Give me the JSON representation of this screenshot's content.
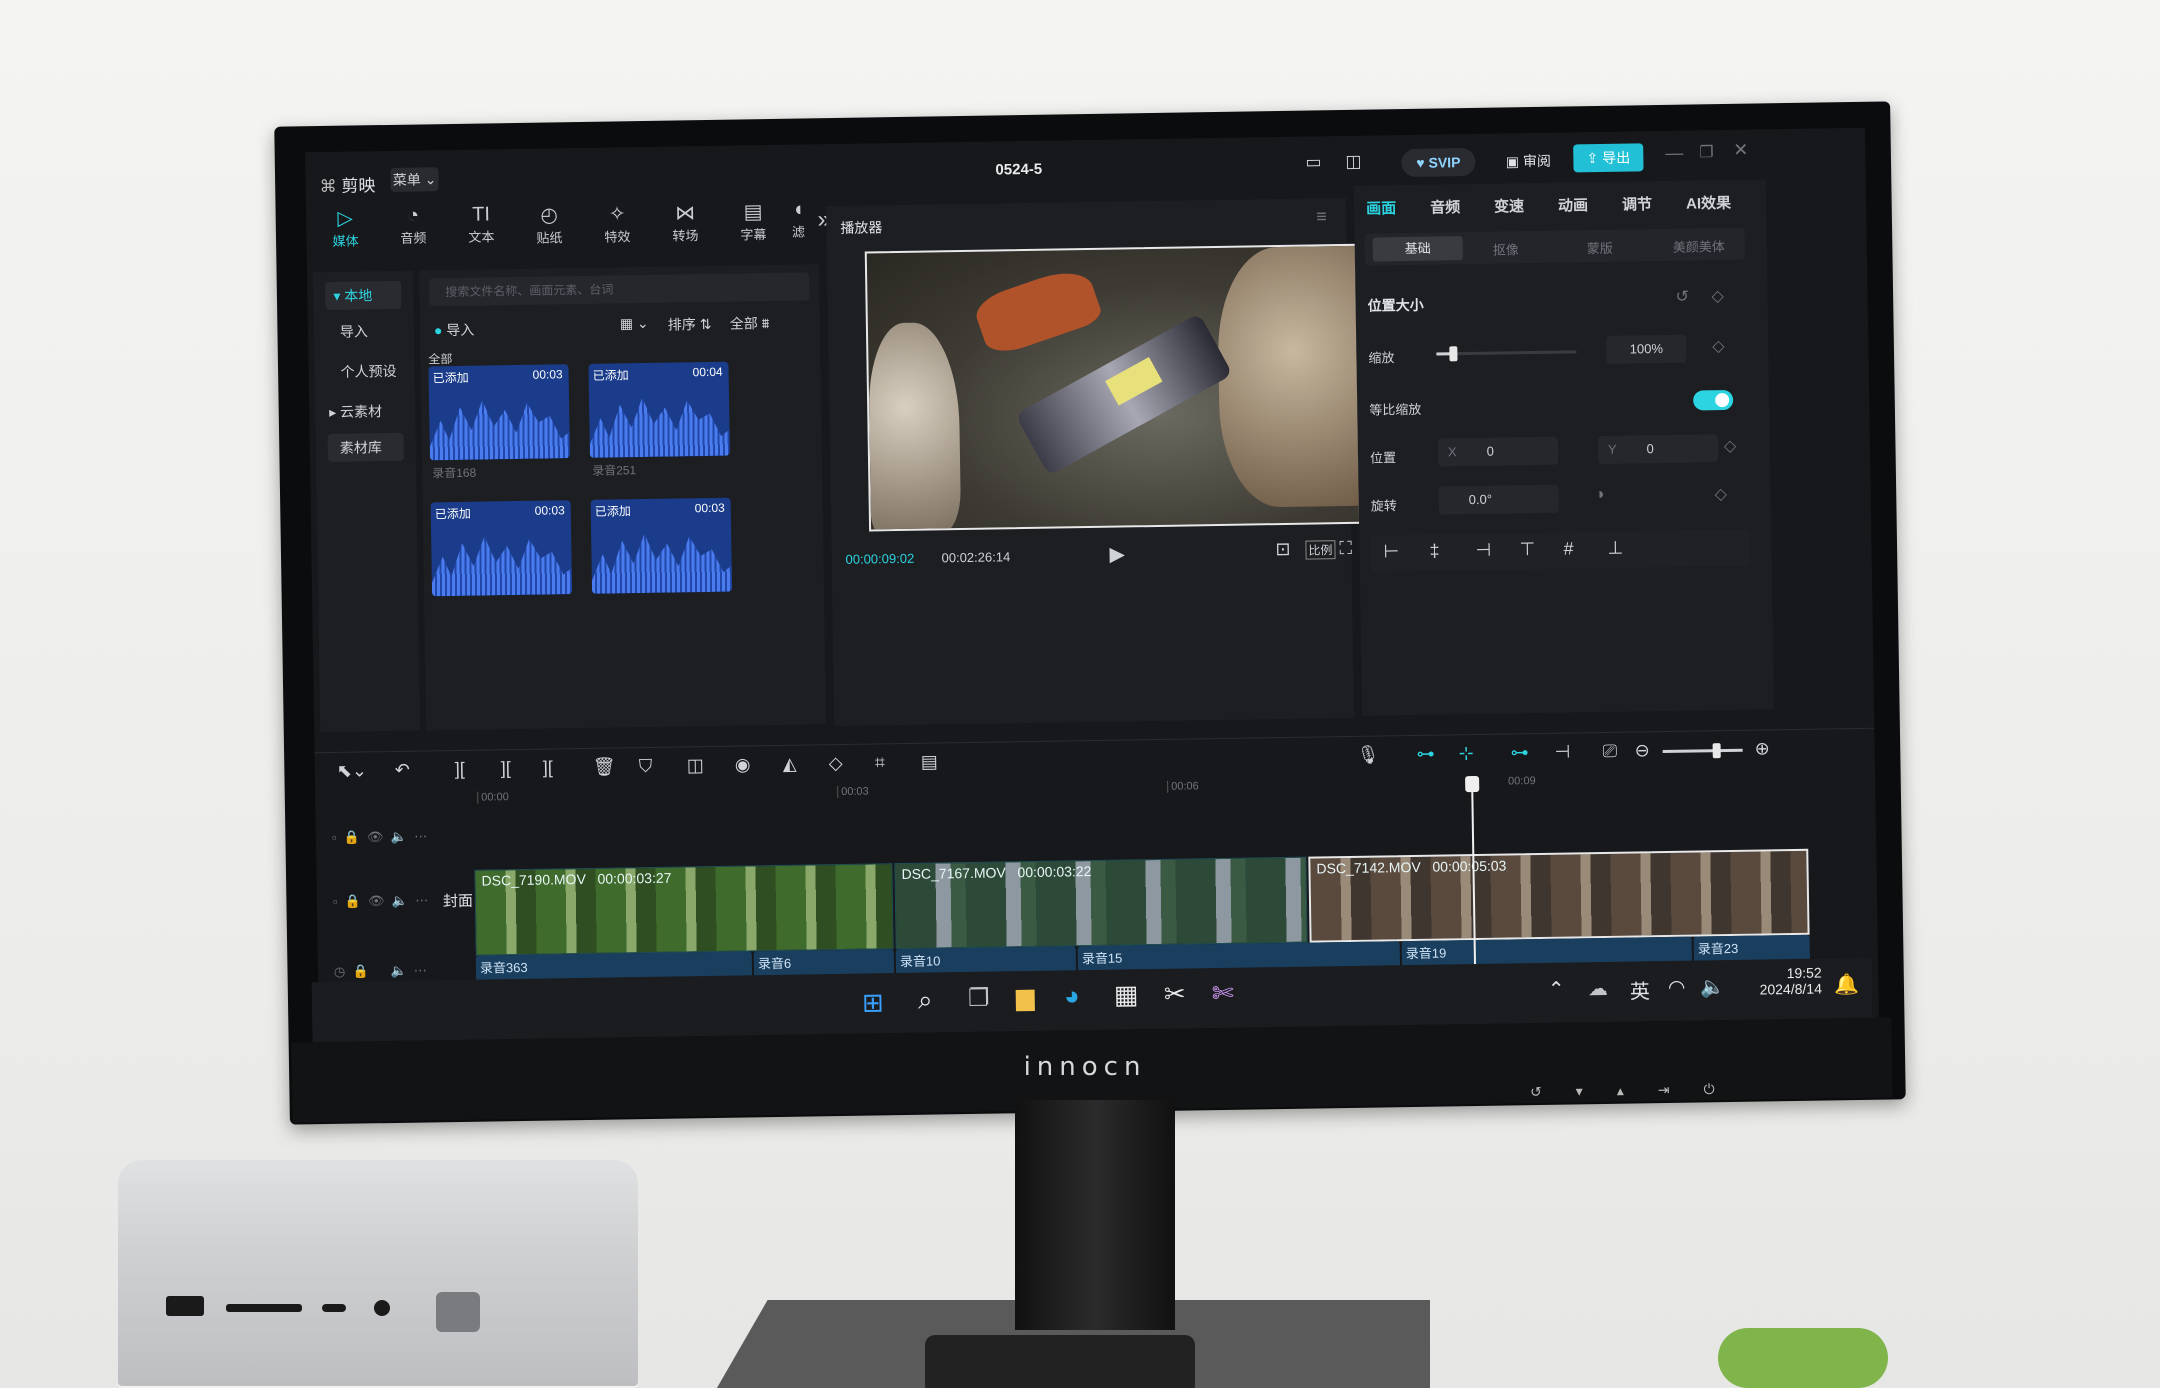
{
  "app": {
    "logo": "剪映",
    "menu": "菜单",
    "project_title": "0524-5",
    "svip": "SVIP",
    "review": "审阅",
    "export": "导出"
  },
  "toolbar_tabs": [
    {
      "label": "媒体",
      "icon": "media-icon"
    },
    {
      "label": "音频",
      "icon": "audio-icon"
    },
    {
      "label": "文本",
      "icon": "text-icon",
      "glyph": "TI"
    },
    {
      "label": "贴纸",
      "icon": "sticker-icon"
    },
    {
      "label": "特效",
      "icon": "effects-icon"
    },
    {
      "label": "转场",
      "icon": "transition-icon"
    },
    {
      "label": "字幕",
      "icon": "caption-icon"
    },
    {
      "label": "滤",
      "icon": "filter-icon"
    }
  ],
  "sidebar": {
    "items": [
      "本地",
      "导入",
      "个人预设",
      "云素材",
      "素材库"
    ]
  },
  "media": {
    "search_placeholder": "搜索文件名称、画面元素、台词",
    "import": "导入",
    "sort": "排序",
    "filter": "全部",
    "section_all": "全部",
    "items": [
      {
        "tag": "已添加",
        "duration": "00:03",
        "name": "录音168"
      },
      {
        "tag": "已添加",
        "duration": "00:04",
        "name": "录音251"
      },
      {
        "tag": "已添加",
        "duration": "00:03",
        "name": ""
      },
      {
        "tag": "已添加",
        "duration": "00:03",
        "name": ""
      }
    ]
  },
  "player": {
    "title": "播放器",
    "current_time": "00:00:09:02",
    "total_time": "00:02:26:14",
    "ratio": "比例"
  },
  "inspector": {
    "tabs": [
      "画面",
      "音频",
      "变速",
      "动画",
      "调节",
      "AI效果"
    ],
    "subtabs": [
      "基础",
      "抠像",
      "蒙版",
      "美颜美体"
    ],
    "section": "位置大小",
    "scale_label": "缩放",
    "scale_value": "100%",
    "scale_fraction": 0.12,
    "uniform_label": "等比缩放",
    "position_label": "位置",
    "x_label": "X",
    "x_value": "0",
    "y_label": "Y",
    "y_value": "0",
    "rotate_label": "旋转",
    "rotate_value": "0.0°"
  },
  "timeline": {
    "ticks": [
      "00:00",
      "00:03",
      "00:06",
      "00:09"
    ],
    "cover": "封面",
    "video_clips": [
      {
        "name": "DSC_7190.MOV",
        "time": "00:00:03:27"
      },
      {
        "name": "DSC_7167.MOV",
        "time": "00:00:03:22"
      },
      {
        "name": "DSC_7142.MOV",
        "time": "00:00:05:03"
      }
    ],
    "audio_clips": [
      "录音363",
      "录音6",
      "录音10",
      "录音15",
      "录音19",
      "录音23"
    ]
  },
  "taskbar": {
    "time": "19:52",
    "date": "2024/8/14",
    "ime": "英"
  },
  "monitor_brand": "innocn",
  "colors": {
    "accent": "#2bd4e0",
    "panel": "#1d1e22",
    "bg": "#17181b"
  }
}
